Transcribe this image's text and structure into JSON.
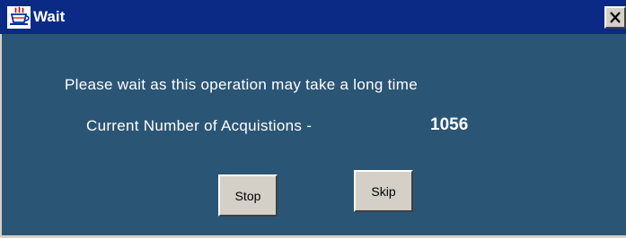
{
  "window": {
    "title": "Wait",
    "icon": "java-coffee-cup-icon",
    "close_glyph": "X"
  },
  "dialog": {
    "message": "Please wait as this operation may take a long time",
    "acquisitions_label": "Current Number of Acquistions -",
    "acquisitions_value": "1056"
  },
  "buttons": {
    "stop_label": "Stop",
    "skip_label": "Skip"
  },
  "colors": {
    "titlebar": "#0a2a86",
    "content_background": "#2b5575",
    "button_face": "#d4d0c8",
    "text": "#ffffff"
  }
}
